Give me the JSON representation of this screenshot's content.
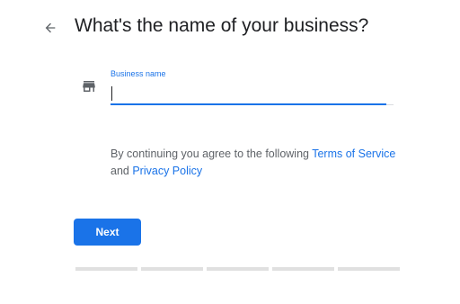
{
  "header": {
    "back_icon": "arrow-back-icon",
    "title": "What's the name of your business?"
  },
  "form": {
    "field_icon": "storefront-icon",
    "business_name": {
      "label": "Business name",
      "value": "",
      "placeholder": ""
    }
  },
  "legal": {
    "prefix": "By continuing you agree to the following ",
    "terms_link": "Terms of Service",
    "conjunction": " and ",
    "privacy_link": "Privacy Policy"
  },
  "actions": {
    "next_label": "Next"
  },
  "progress": {
    "steps": 5,
    "completed": 0
  },
  "colors": {
    "accent": "#1a73e8",
    "text_primary": "#202124",
    "text_secondary": "#5f6368",
    "track": "#e0e0e0"
  }
}
